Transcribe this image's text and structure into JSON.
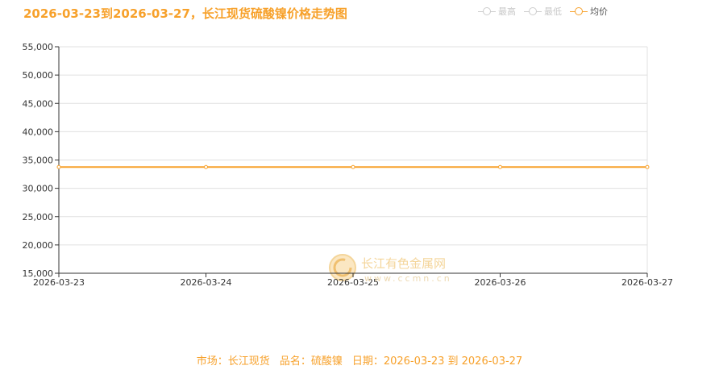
{
  "title": "2026-03-23到2026-03-27，长江现货硫酸镍价格走势图",
  "legend": [
    {
      "label": "最高",
      "color": "#cccccc",
      "active": false
    },
    {
      "label": "最低",
      "color": "#cccccc",
      "active": false
    },
    {
      "label": "均价",
      "color": "#f7a12b",
      "active": true
    }
  ],
  "watermark": {
    "text": "长江有色金属网",
    "url": "www.ccmn.cn",
    "icon": "ccmn-logo-icon"
  },
  "footer": {
    "market": "市场：长江现货",
    "product": "品名：硫酸镍",
    "date": "日期：2026-03-23 到 2026-03-27"
  },
  "chart_data": {
    "type": "line",
    "title": "2026-03-23到2026-03-27，长江现货硫酸镍价格走势图",
    "categories": [
      "2026-03-23",
      "2026-03-24",
      "2026-03-25",
      "2026-03-26",
      "2026-03-27"
    ],
    "series": [
      {
        "name": "均价",
        "values": [
          33750,
          33750,
          33750,
          33750,
          33750
        ],
        "color": "#f7a12b"
      }
    ],
    "ylim": [
      15000,
      55000
    ],
    "yticks": [
      15000,
      20000,
      25000,
      30000,
      35000,
      40000,
      45000,
      50000,
      55000
    ],
    "ytick_labels": [
      "15,000",
      "20,000",
      "25,000",
      "30,000",
      "35,000",
      "40,000",
      "45,000",
      "50,000",
      "55,000"
    ],
    "grid": true,
    "legend_position": "top-right",
    "xlabel": "",
    "ylabel": ""
  }
}
